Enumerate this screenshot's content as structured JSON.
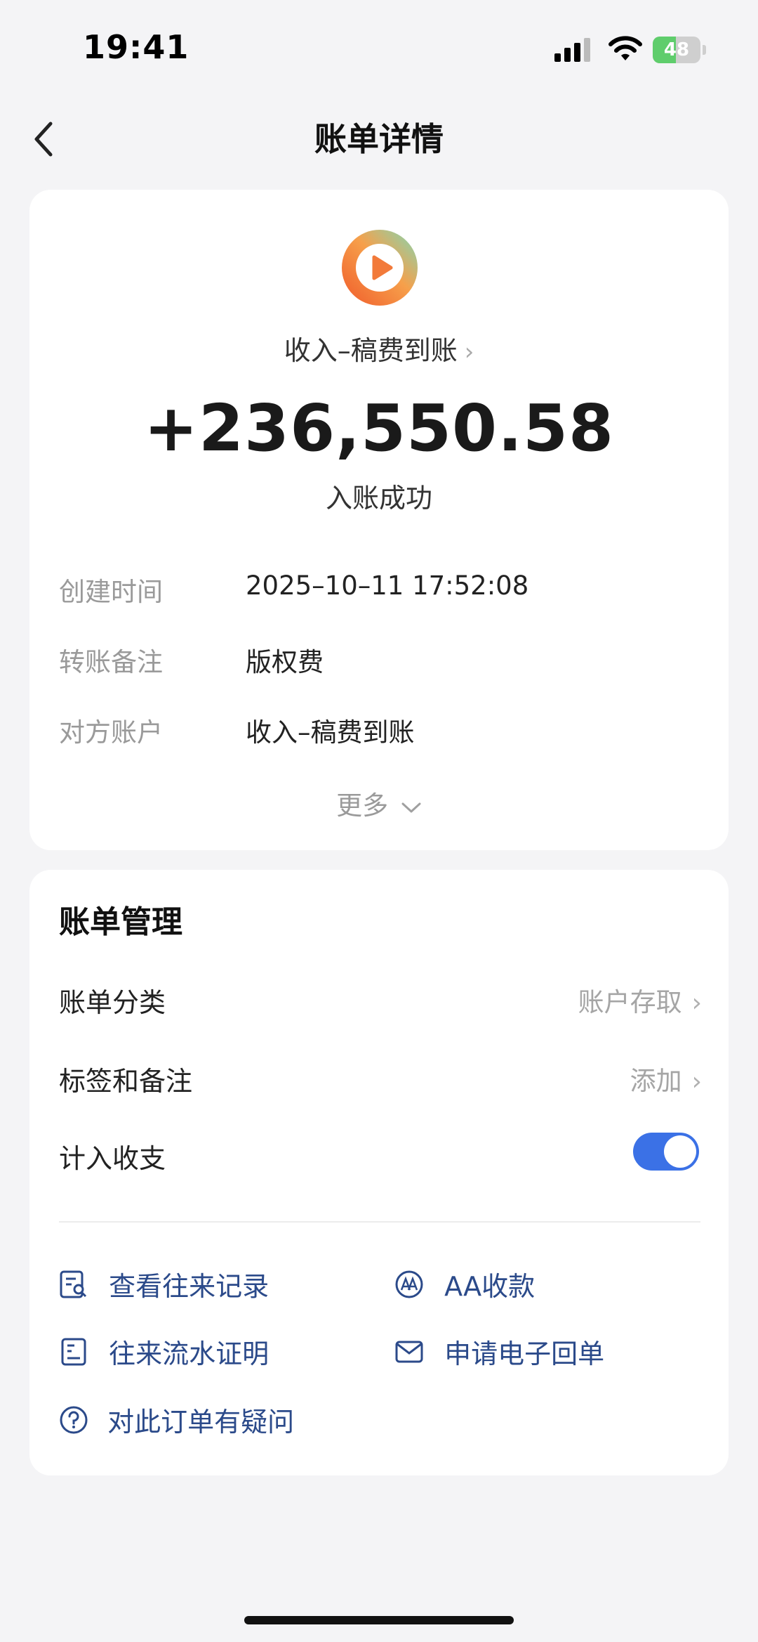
{
  "status_bar": {
    "time": "19:41",
    "battery": "48",
    "battery_level": 0.48
  },
  "nav": {
    "title": "账单详情",
    "back_icon": "chevron-left-icon"
  },
  "summary": {
    "app_icon": "play-icon",
    "merchant": "收入–稿费到账",
    "amount": "+236,550.58",
    "status": "入账成功"
  },
  "details": [
    {
      "label": "创建时间",
      "value": "2025–10–11 17:52:08"
    },
    {
      "label": "转账备注",
      "value": "版权费"
    },
    {
      "label": "对方账户",
      "value": "收入–稿费到账"
    }
  ],
  "more_label": "更多",
  "management": {
    "title": "账单管理",
    "category_label": "账单分类",
    "category_value": "账户存取",
    "tags_label": "标签和备注",
    "tags_value": "添加",
    "count_label": "计入收支",
    "count_enabled": true
  },
  "links": {
    "records": "查看往来记录",
    "aa": "AA收款",
    "proof": "往来流水证明",
    "receipt": "申请电子回单",
    "question": "对此订单有疑问"
  },
  "colors": {
    "accent": "#3b71e6",
    "link": "#2b4a8a",
    "background": "#f4f4f6"
  }
}
